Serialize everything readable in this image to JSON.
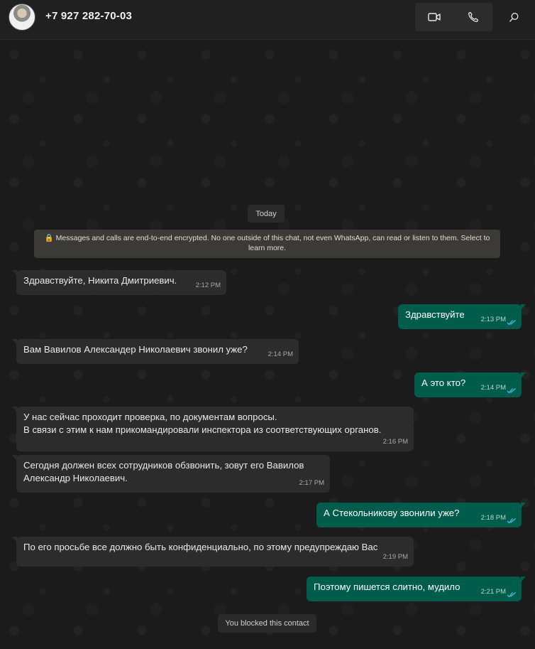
{
  "header": {
    "contact_name": "+7 927 282-70-03",
    "avatar_icon": "contact-photo",
    "video_call_icon": "video-camera-icon",
    "voice_call_icon": "phone-icon",
    "search_icon": "search-icon"
  },
  "chat": {
    "date_label": "Today",
    "encryption_notice": "🔒 Messages and calls are end-to-end encrypted. No one outside of this chat, not even WhatsApp, can read or listen to them. Select to learn more.",
    "messages": [
      {
        "direction": "in",
        "text": "Здравствуйте, Никита Дмитриевич.",
        "time": "2:12 PM"
      },
      {
        "direction": "out",
        "text": "Здравствуйте",
        "time": "2:13 PM",
        "status": "read"
      },
      {
        "direction": "in",
        "text": "Вам Вавилов Александер Николаевич звонил уже?",
        "time": "2:14 PM"
      },
      {
        "direction": "out",
        "text": "А это кто?",
        "time": "2:14 PM",
        "status": "read"
      },
      {
        "direction": "in",
        "text_line1": "У нас сейчас проходит проверка, по документам вопросы.",
        "text_line2": "В связи с этим к нам прикомандировали инспектора из соответствующих органов.",
        "time": "2:16 PM"
      },
      {
        "direction": "in",
        "text_line1": "Сегодня должен всех сотрудников обзвонить, зовут его Вавилов",
        "text_line2": "Александр Николаевич.",
        "time": "2:17 PM"
      },
      {
        "direction": "out",
        "text": "А Стекольникову звонили уже?",
        "time": "2:18 PM",
        "status": "read"
      },
      {
        "direction": "in",
        "text": "По его просьбе все должно быть конфиденциально, по этому  предупреждаю Вас",
        "time": "2:19 PM"
      },
      {
        "direction": "out",
        "text": "Поэтому пишется слитно, мудило",
        "time": "2:21 PM",
        "status": "read"
      }
    ],
    "blocked_notice": "You blocked this contact"
  },
  "colors": {
    "incoming_bubble": "#2c2c2c",
    "outgoing_bubble": "#005c4b",
    "read_ticks": "#53bdeb",
    "header_bg": "#202020"
  }
}
